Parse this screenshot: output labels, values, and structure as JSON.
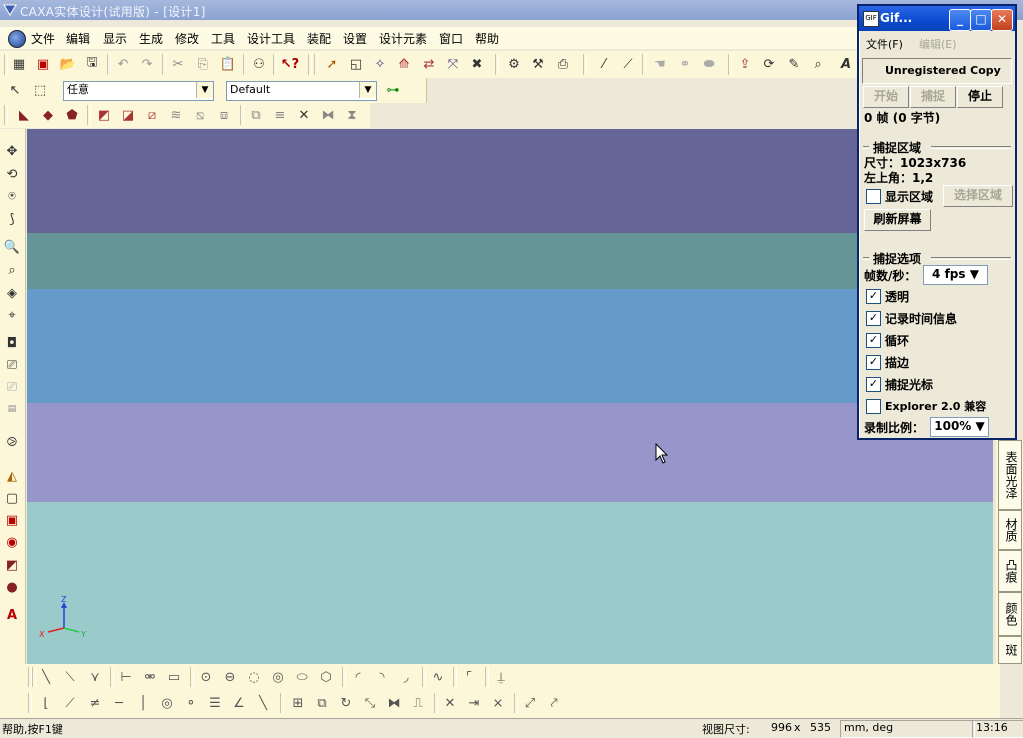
{
  "window": {
    "title": "CAXA实体设计(试用版) - [设计1]"
  },
  "menu": [
    "文件",
    "编辑",
    "显示",
    "生成",
    "修改",
    "工具",
    "设计工具",
    "装配",
    "设置",
    "设计元素",
    "窗口",
    "帮助"
  ],
  "selectors": {
    "filter": "任意",
    "style": "Default"
  },
  "canvas_colors": [
    "#656597",
    "#659596",
    "#659ac9",
    "#9796ca",
    "#9acac9"
  ],
  "axes": {
    "x": "X",
    "y": "Y",
    "z": "Z"
  },
  "right_tabs": [
    "表面光泽",
    "材质",
    "凸痕",
    "颜色",
    "斑"
  ],
  "status": {
    "help": "帮助,按F1键",
    "view_label": "视图尺寸:",
    "view_w": "996",
    "view_x": "x",
    "view_h": "535",
    "units": "mm, deg",
    "time": "13:16"
  },
  "gif": {
    "title": "Gif...",
    "menu_file": "文件(F)",
    "menu_edit": "编辑(E)",
    "unregistered": "Unregistered Copy",
    "btn_start": "开始",
    "btn_capture": "捕捉",
    "btn_stop": "停止",
    "frames": "0 帧 (0 字节)",
    "region_header": "捕捉区域",
    "size": "尺寸：1023x736",
    "topleft": "左上角：1,2",
    "show_region": "显示区域",
    "select_region": "选择区域",
    "refresh": "刷新屏幕",
    "options_header": "捕捉选项",
    "fps_label": "帧数/秒：",
    "fps_value": "4 fps",
    "opt_transparent": "透明",
    "opt_timeinfo": "记录时间信息",
    "opt_loop": "循环",
    "opt_border": "描边",
    "opt_cursor": "捕捉光标",
    "opt_explorer": "Explorer 2.0 兼容",
    "scale_label": "录制比例：",
    "scale_value": "100%"
  }
}
